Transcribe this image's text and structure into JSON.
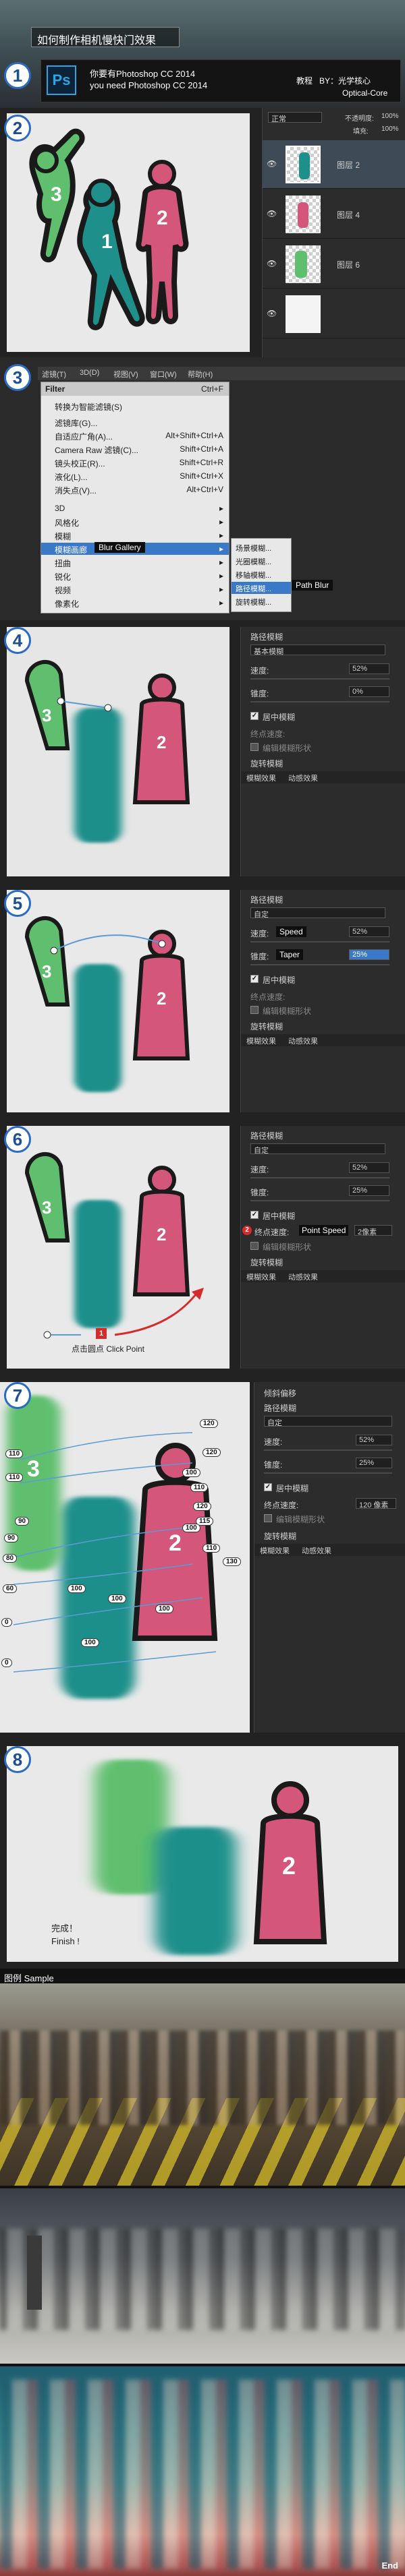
{
  "header": {
    "title": "如何制作相机慢快门效果",
    "ps_icon": "Ps",
    "need_cn": "你要有Photoshop CC 2014",
    "need_en": "you need Photoshop CC 2014",
    "tutorial_label": "教程",
    "author": "BY：光学核心",
    "author_en": "Optical-Core"
  },
  "step1_badge": "1",
  "step2": {
    "badge": "2",
    "blend_mode": "正常",
    "opacity_label": "不透明度:",
    "opacity_value": "100%",
    "fill_label": "填充:",
    "fill_value": "100%",
    "figure_labels": [
      "3",
      "1",
      "2"
    ],
    "layers": [
      {
        "name": "图层 2"
      },
      {
        "name": "图层 4"
      },
      {
        "name": "图层 6"
      },
      {
        "name": ""
      }
    ]
  },
  "step3": {
    "badge": "3",
    "menubar": [
      "滤镜(T)",
      "3D(D)",
      "视图(V)",
      "窗口(W)",
      "帮助(H)"
    ],
    "filter_top": "Filter",
    "filter_top_shortcut": "Ctrl+F",
    "items": [
      {
        "label": "转换为智能滤镜(S)",
        "shortcut": ""
      },
      {
        "label": "滤镜库(G)...",
        "shortcut": ""
      },
      {
        "label": "自适应广角(A)...",
        "shortcut": "Alt+Shift+Ctrl+A"
      },
      {
        "label": "Camera Raw 滤镜(C)...",
        "shortcut": "Shift+Ctrl+A"
      },
      {
        "label": "镜头校正(R)...",
        "shortcut": "Shift+Ctrl+R"
      },
      {
        "label": "液化(L)...",
        "shortcut": "Shift+Ctrl+X"
      },
      {
        "label": "消失点(V)...",
        "shortcut": "Alt+Ctrl+V"
      },
      {
        "label": "3D",
        "shortcut": "▸"
      },
      {
        "label": "风格化",
        "shortcut": "▸"
      },
      {
        "label": "模糊",
        "shortcut": "▸"
      },
      {
        "label": "模糊画廊",
        "shortcut": "▸"
      },
      {
        "label": "扭曲",
        "shortcut": "▸"
      },
      {
        "label": "锐化",
        "shortcut": "▸"
      },
      {
        "label": "视频",
        "shortcut": "▸"
      },
      {
        "label": "像素化",
        "shortcut": "▸"
      }
    ],
    "blur_gallery_tag": "Blur Gallery",
    "submenu": [
      "场景模糊...",
      "光圈模糊...",
      "移轴模糊...",
      "路径模糊...",
      "旋转模糊..."
    ],
    "path_blur_tag": "Path Blur"
  },
  "step4": {
    "badge": "4",
    "panel_title": "路径模糊",
    "preset": "基本模糊",
    "speed_label": "速度:",
    "speed_value": "52%",
    "taper_label": "锥度:",
    "taper_value": "0%",
    "centered_label": "居中模糊",
    "endpoint_label": "终点速度:",
    "editor_label": "编辑模糊形状",
    "section1": "旋转模糊",
    "section2": "模糊效果",
    "section3": "动感效果"
  },
  "step5": {
    "badge": "5",
    "panel_title": "路径模糊",
    "preset": "自定",
    "speed_label": "速度:",
    "speed_tag": "Speed",
    "speed_value": "52%",
    "taper_label": "锥度:",
    "taper_tag": "Taper",
    "taper_value": "25%",
    "centered_label": "居中模糊",
    "endpoint_label": "终点速度:",
    "editor_label": "编辑模糊形状",
    "section1": "旋转模糊",
    "section2": "模糊效果",
    "section3": "动感效果"
  },
  "step6": {
    "badge": "6",
    "panel_title": "路径模糊",
    "preset": "自定",
    "speed_label": "速度:",
    "speed_value": "52%",
    "taper_label": "锥度:",
    "taper_value": "25%",
    "centered_label": "居中模糊",
    "marker_num": "2",
    "endpoint_label": "终点速度:",
    "endpoint_tag": "Point Speed",
    "endpoint_value": "2像素",
    "editor_label": "编辑模糊形状",
    "section1": "旋转模糊",
    "section2": "模糊效果",
    "section3": "动感效果",
    "click_num": "1",
    "click_text": "点击圆点 Click Point"
  },
  "step7": {
    "badge": "7",
    "section_top": "倾斜偏移",
    "panel_title": "路径模糊",
    "preset": "自定",
    "speed_label": "速度:",
    "speed_value": "52%",
    "taper_label": "锥度:",
    "taper_value": "25%",
    "centered_label": "居中模糊",
    "endpoint_label": "终点速度:",
    "endpoint_value": "120 像素",
    "editor_label": "编辑模糊形状",
    "section1": "旋转模糊",
    "section2": "模糊效果",
    "section3": "动感效果",
    "point_values": [
      "120",
      "110",
      "110",
      "120",
      "100",
      "110",
      "120",
      "115",
      "90",
      "100",
      "90",
      "80",
      "110",
      "130",
      "60",
      "100",
      "100",
      "100",
      "0",
      "100",
      "0"
    ]
  },
  "step8": {
    "badge": "8",
    "finish_cn": "完成！",
    "finish_en": "Finish !"
  },
  "sample": {
    "label": "图例 Sample"
  },
  "footer": {
    "end": "End"
  },
  "colors": {
    "green": "#5fbf6e",
    "teal": "#1e8f8a",
    "pink": "#d4567a",
    "outline": "#1a1a1a",
    "accent_blue": "#2a6ac2",
    "ps_panel": "#2c2c2c"
  }
}
